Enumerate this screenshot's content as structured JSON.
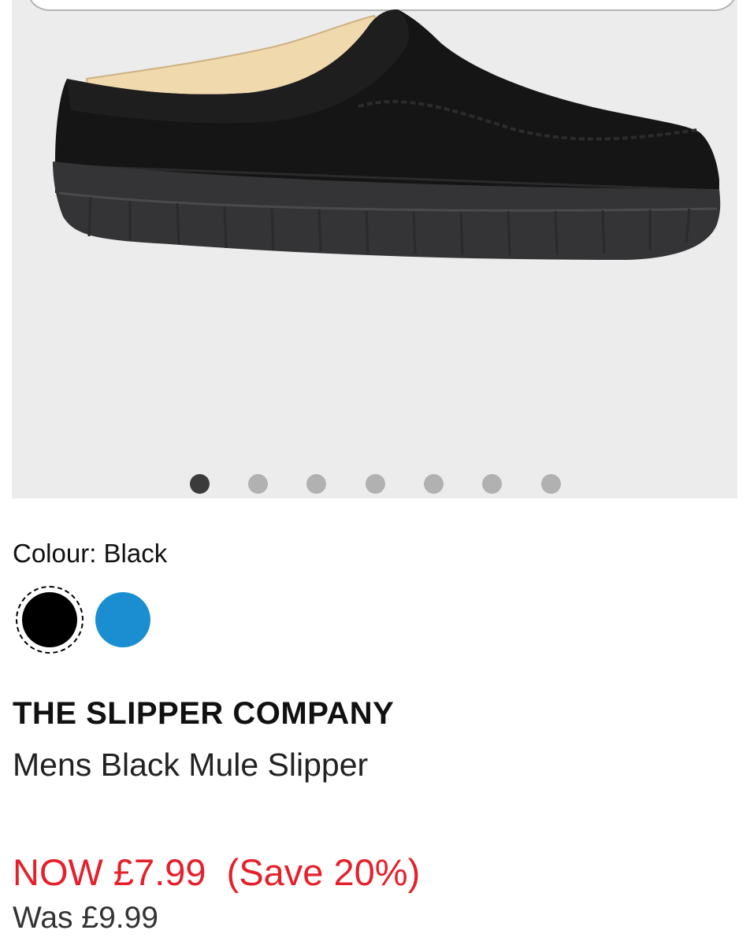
{
  "gallery": {
    "image_alt": "Mens Black Mule Slipper",
    "slide_count": 7,
    "active_slide": 1
  },
  "colour": {
    "label": "Colour: Black",
    "options": [
      {
        "name": "Black",
        "hex": "#000000",
        "selected": true
      },
      {
        "name": "Blue",
        "hex": "#1a8ed0",
        "selected": false
      }
    ]
  },
  "product": {
    "brand": "THE SLIPPER COMPANY",
    "name": "Mens Black Mule Slipper"
  },
  "pricing": {
    "now": "NOW £7.99",
    "save": "(Save 20%)",
    "was": "Was £9.99",
    "sale_color": "#e5202a"
  }
}
